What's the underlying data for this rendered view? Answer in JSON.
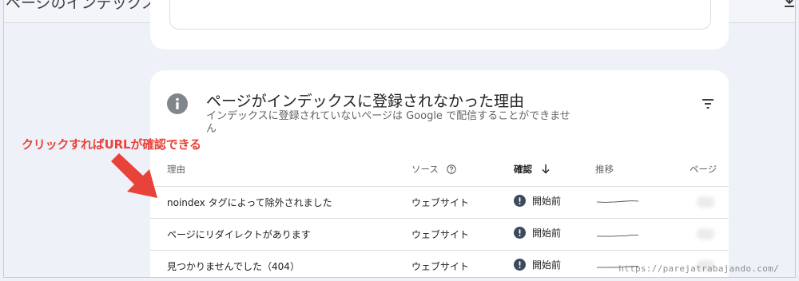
{
  "header": {
    "title": "ページのインデックス登録"
  },
  "card": {
    "title": "ページがインデックスに登録されなかった理由",
    "subtitle": "インデックスに登録されていないページは Google で配信することができません"
  },
  "table": {
    "columns": {
      "reason": "理由",
      "source": "ソース",
      "validation": "確認",
      "trend": "推移",
      "pages": "ページ"
    },
    "rows": [
      {
        "reason": "noindex タグによって除外されました",
        "source": "ウェブサイト",
        "status": "開始前"
      },
      {
        "reason": "ページにリダイレクトがあります",
        "source": "ウェブサイト",
        "status": "開始前"
      },
      {
        "reason": "見つかりませんでした（404）",
        "source": "ウェブサイト",
        "status": "開始前"
      }
    ]
  },
  "annotation": {
    "text": "クリックすればURLが確認できる",
    "color": "#e8433a"
  },
  "watermark": "https://parejatrabajando.com/",
  "icons": {
    "info": "info-icon",
    "filter": "filter-icon",
    "help": "help-circle-icon",
    "sort": "arrow-down-icon",
    "status": "exclamation-circle-icon",
    "download": "download-icon"
  }
}
